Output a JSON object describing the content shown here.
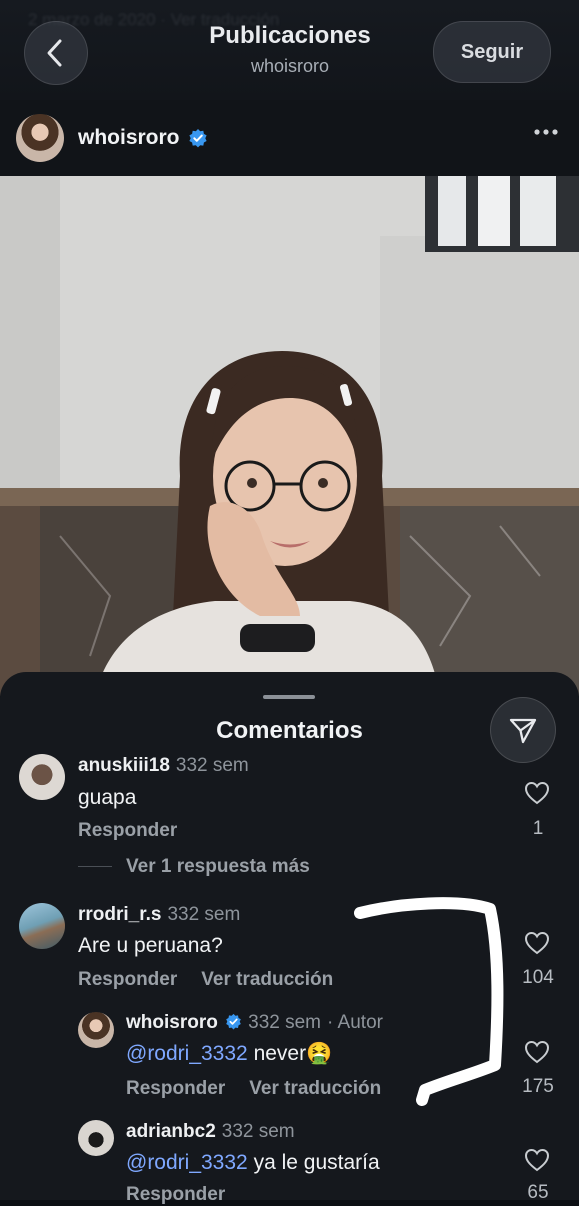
{
  "header": {
    "title": "Publicaciones",
    "subtitle": "whoisroro",
    "follow_label": "Seguir",
    "ghost_text": "2 marzo de 2020 · Ver traducción"
  },
  "post": {
    "author": "whoisroro",
    "verified": true
  },
  "sheet": {
    "title": "Comentarios"
  },
  "comments": [
    {
      "user": "anuskiii18",
      "time": "332 sem",
      "text": "guapa",
      "reply_label": "Responder",
      "likes": "1",
      "view_more": "Ver 1 respuesta más"
    },
    {
      "user": "rrodri_r.s",
      "time": "332 sem",
      "text": "Are u peruana?",
      "reply_label": "Responder",
      "translate_label": "Ver traducción",
      "likes": "104"
    },
    {
      "user": "whoisroro",
      "time": "332 sem",
      "author_tag": "· Autor",
      "mention": "@rodri_3332",
      "text": " never",
      "emoji": "🤮",
      "reply_label": "Responder",
      "translate_label": "Ver traducción",
      "likes": "175"
    },
    {
      "user": "adrianbc2",
      "time": "332 sem",
      "mention": "@rodri_3332",
      "text": " ya le gustaría",
      "reply_label": "Responder",
      "likes": "65"
    }
  ],
  "icons": {
    "back": "chevron-left-icon",
    "verified": "verified-badge-icon",
    "more": "more-horizontal-icon",
    "send": "send-icon",
    "like": "heart-icon"
  },
  "colors": {
    "background": "#0c0f14",
    "sheet": "#15181d",
    "mention": "#7fa8ff",
    "verified": "#3897f0"
  }
}
